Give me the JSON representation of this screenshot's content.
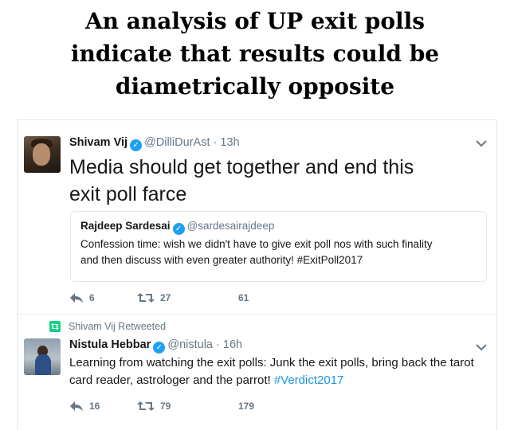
{
  "headline": {
    "line1": "An analysis of UP exit polls",
    "line2": "indicate that results could be",
    "line3": "diametrically opposite"
  },
  "tweet1": {
    "name": "Shivam Vij",
    "handle": "@DilliDurAst",
    "dot": "·",
    "time": "13h",
    "text_line1": "Media should get together and end this",
    "text_line2": "exit poll farce",
    "quote": {
      "name": "Rajdeep Sardesai",
      "handle": "@sardesairajdeep",
      "text_line1": "Confession time: wish we didn't have to give exit poll nos with such finality",
      "text_line2": "and then discuss with even greater authority! #ExitPoll2017"
    },
    "replies": "6",
    "retweets": "27",
    "likes": "61"
  },
  "tweet2": {
    "retweeted_by": "Shivam Vij Retweeted",
    "name": "Nistula Hebbar",
    "handle": "@nistula",
    "dot": "·",
    "time": "16h",
    "text_main": "Learning from watching the exit polls: Junk the exit polls, bring back the tarot card reader, astrologer and the parrot! ",
    "hashtag": "#Verdict2017",
    "replies": "16",
    "retweets": "79",
    "likes": "179"
  },
  "colors": {
    "link": "#1b95e0",
    "verified": "#1da1f2",
    "muted": "#657786",
    "retweet_badge": "#19cf86"
  },
  "icons": [
    "verified-badge-icon",
    "chevron-down-icon",
    "reply-icon",
    "retweet-icon",
    "retweeted-badge-icon"
  ]
}
